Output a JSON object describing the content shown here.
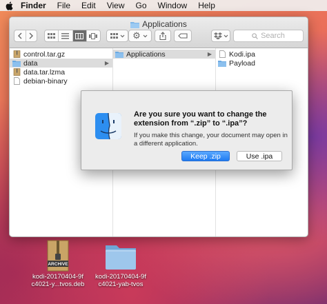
{
  "menubar": {
    "app": "Finder",
    "items": [
      "File",
      "Edit",
      "View",
      "Go",
      "Window",
      "Help"
    ]
  },
  "window": {
    "title": "Applications",
    "search_placeholder": "Search"
  },
  "columns": {
    "col1": [
      {
        "label": "control.tar.gz",
        "icon": "archive-icon",
        "selected": false
      },
      {
        "label": "data",
        "icon": "folder-icon",
        "selected": true,
        "has_children": true
      },
      {
        "label": "data.tar.lzma",
        "icon": "archive-icon",
        "selected": false
      },
      {
        "label": "debian-binary",
        "icon": "document-icon",
        "selected": false
      }
    ],
    "col2": [
      {
        "label": "Applications",
        "icon": "folder-icon",
        "selected": true,
        "has_children": true
      }
    ],
    "col3": [
      {
        "label": "Kodi.ipa",
        "icon": "document-icon",
        "selected": false
      },
      {
        "label": "Payload",
        "icon": "folder-icon",
        "selected": false
      }
    ]
  },
  "dialog": {
    "title": "Are you sure you want to change the extension from “.zip” to “.ipa”?",
    "message": "If you make this change, your document may open in a different application.",
    "primary_button": "Keep .zip",
    "secondary_button": "Use .ipa"
  },
  "desktop": {
    "items": [
      {
        "line1": "kodi-20170404-9f",
        "line2": "c4021-y...tvos.deb",
        "badge": "ARCHIVE",
        "icon": "archive-icon"
      },
      {
        "line1": "kodi-20170404-9f",
        "line2": "c4021-yab-tvos",
        "icon": "folder-icon"
      }
    ]
  },
  "colors": {
    "accent": "#1f7bf2",
    "folder": "#7eb6e8"
  }
}
